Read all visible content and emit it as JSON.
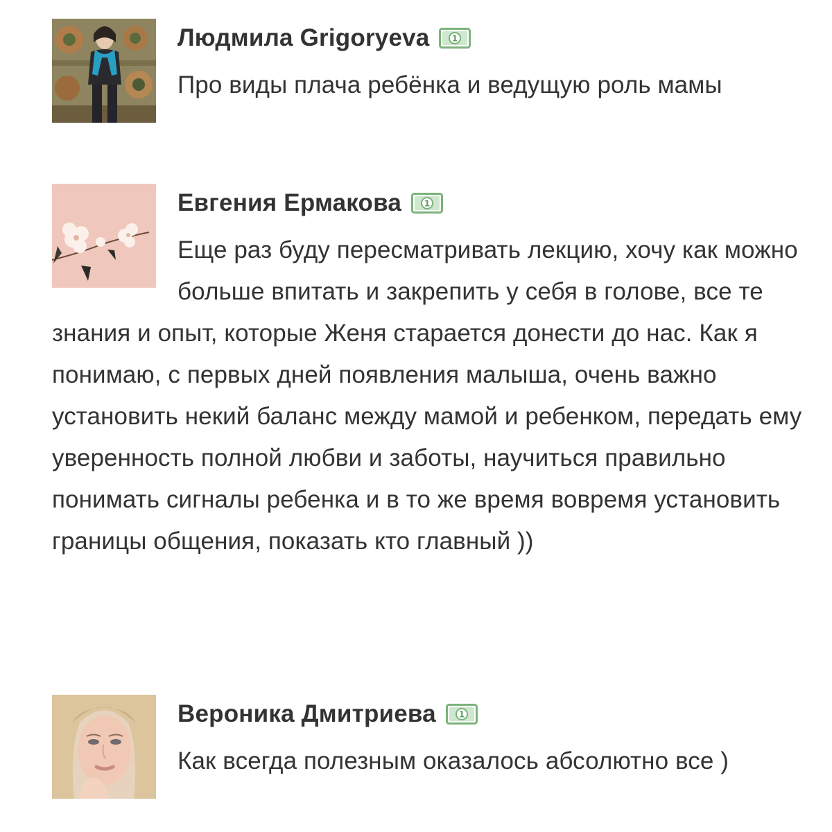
{
  "comments": [
    {
      "author": "Людмила Grigoryeva",
      "avatar_icon": "avatar-photo-woman-tapestry",
      "badge_icon": "money-bill-icon",
      "text": "Про виды плача ребёнка и ведущую роль мамы"
    },
    {
      "author": "Евгения Ермакова",
      "avatar_icon": "avatar-photo-flowers",
      "badge_icon": "money-bill-icon",
      "text": "Еще раз буду пересматривать лекцию, хочу как можно больше впитать и закрепить у себя в голове, все те знания и опыт, которые Женя старается донести до нас. Как я понимаю, с первых дней появления малыша, очень важно установить некий баланс между мамой и ребенком, передать ему уверенность полной любви и заботы, научиться правильно понимать сигналы ребенка и в то же время вовремя установить границы общения, показать кто главный ))"
    },
    {
      "author": "Вероника Дмитриева",
      "avatar_icon": "avatar-photo-woman-blonde",
      "badge_icon": "money-bill-icon",
      "text": "Как всегда полезным оказалось абсолютно все )"
    }
  ],
  "colors": {
    "text": "#333333",
    "badge_green": "#7bb37b",
    "background": "#ffffff"
  }
}
